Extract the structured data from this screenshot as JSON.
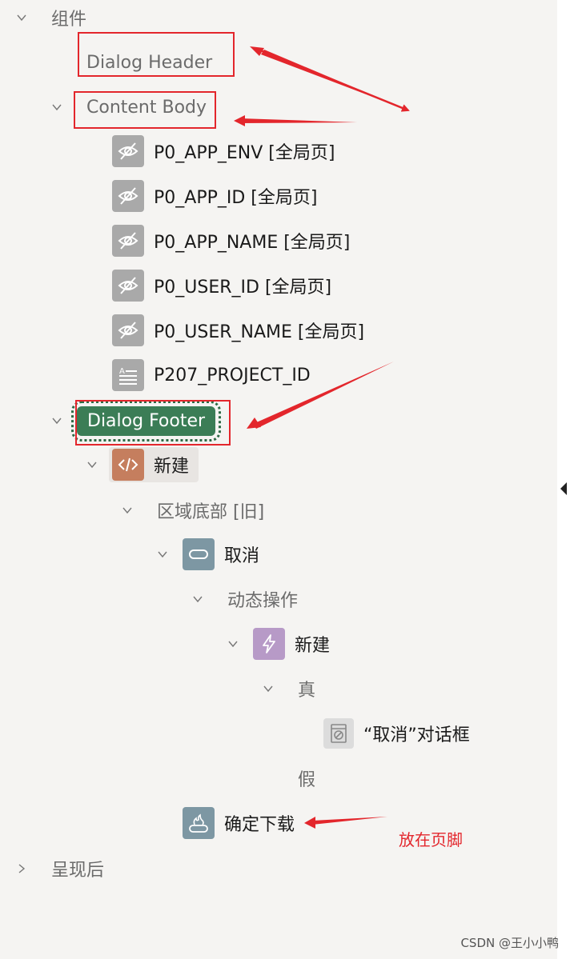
{
  "tree": {
    "components_label": "组件",
    "dialog_header": "Dialog Header",
    "content_body": "Content Body",
    "items": [
      {
        "label": "P0_APP_ENV [全局页]",
        "icon": "hidden-item-icon"
      },
      {
        "label": "P0_APP_ID [全局页]",
        "icon": "hidden-item-icon"
      },
      {
        "label": "P0_APP_NAME [全局页]",
        "icon": "hidden-item-icon"
      },
      {
        "label": "P0_USER_ID [全局页]",
        "icon": "hidden-item-icon"
      },
      {
        "label": "P0_USER_NAME [全局页]",
        "icon": "hidden-item-icon"
      },
      {
        "label": "P207_PROJECT_ID",
        "icon": "text-field-icon"
      }
    ],
    "dialog_footer": "Dialog Footer",
    "new_region": "新建",
    "region_bottom": "区域底部 [旧]",
    "cancel_button": "取消",
    "dynamic_actions": "动态操作",
    "da_new": "新建",
    "true_branch": "真",
    "cancel_dialog": "“取消”对话框",
    "false_branch": "假",
    "confirm_download": "确定下载",
    "after_render": "呈现后"
  },
  "annotation": {
    "footer_note": "放在页脚"
  },
  "watermark": "CSDN @王小小鸭",
  "colors": {
    "selected": "#3b7d56",
    "annotation_red": "#e3262c",
    "background": "#f5f4f2"
  }
}
